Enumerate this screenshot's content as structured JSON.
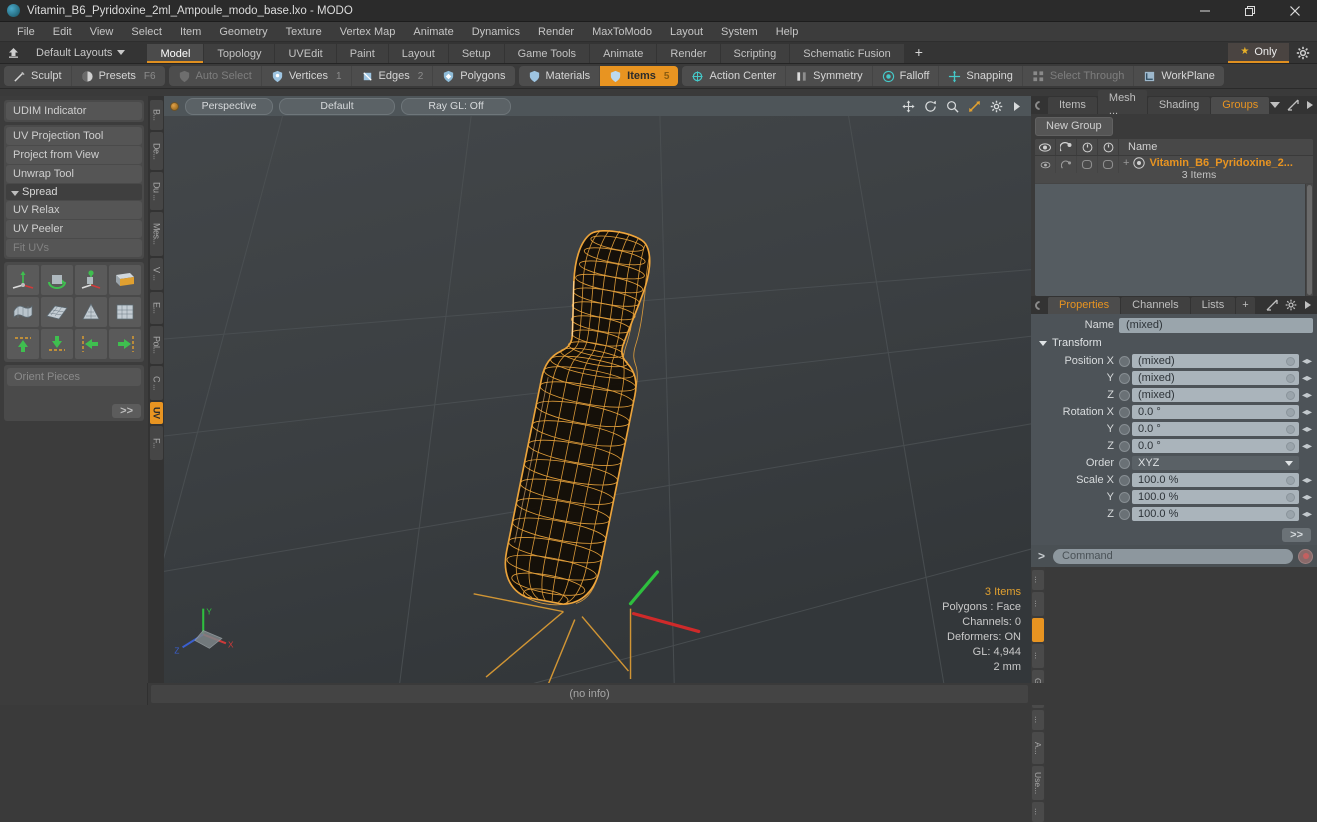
{
  "window": {
    "title": "Vitamin_B6_Pyridoxine_2ml_Ampoule_modo_base.lxo - MODO",
    "minimize": "minimize-icon",
    "restore": "restore-icon",
    "close": "close-icon"
  },
  "menubar": [
    {
      "label": "File"
    },
    {
      "label": "Edit"
    },
    {
      "label": "View"
    },
    {
      "label": "Select"
    },
    {
      "label": "Item"
    },
    {
      "label": "Geometry"
    },
    {
      "label": "Texture"
    },
    {
      "label": "Vertex Map"
    },
    {
      "label": "Animate"
    },
    {
      "label": "Dynamics"
    },
    {
      "label": "Render"
    },
    {
      "label": "MaxToModo"
    },
    {
      "label": "Layout"
    },
    {
      "label": "System"
    },
    {
      "label": "Help"
    }
  ],
  "layoutbar": {
    "home_icon": "home-icon",
    "preset_label": "Default Layouts",
    "tabs": [
      {
        "label": "Model",
        "active": true
      },
      {
        "label": "Topology",
        "active": false
      },
      {
        "label": "UVEdit",
        "active": false
      },
      {
        "label": "Paint",
        "active": false
      },
      {
        "label": "Layout",
        "active": false
      },
      {
        "label": "Setup",
        "active": false
      },
      {
        "label": "Game Tools",
        "active": false
      },
      {
        "label": "Animate",
        "active": false
      },
      {
        "label": "Render",
        "active": false
      },
      {
        "label": "Scripting",
        "active": false
      },
      {
        "label": "Schematic Fusion",
        "active": false
      }
    ],
    "add_tab": "+",
    "only_label": "Only",
    "gear_icon": "gear-icon"
  },
  "modebar": {
    "group1": [
      {
        "label": "Sculpt",
        "icon": "brush-icon",
        "state": "normal",
        "count": ""
      },
      {
        "label": "Presets",
        "icon": "sphere-icon",
        "state": "normal",
        "count": "F6"
      }
    ],
    "group2": [
      {
        "label": "Auto Select",
        "icon": "shield-icon",
        "state": "dim",
        "count": ""
      },
      {
        "label": "Vertices",
        "icon": "vertex-icon",
        "state": "normal",
        "count": "1"
      },
      {
        "label": "Edges",
        "icon": "edge-icon",
        "state": "normal",
        "count": "2"
      },
      {
        "label": "Polygons",
        "icon": "polygon-icon",
        "state": "normal",
        "count": ""
      }
    ],
    "group3": [
      {
        "label": "Materials",
        "icon": "material-icon",
        "state": "normal",
        "count": ""
      },
      {
        "label": "Items",
        "icon": "items-icon",
        "state": "on",
        "count": "5"
      }
    ],
    "group4": [
      {
        "label": "Action Center",
        "icon": "action-center-icon",
        "state": "normal",
        "count": ""
      },
      {
        "label": "Symmetry",
        "icon": "symmetry-icon",
        "state": "normal",
        "count": ""
      },
      {
        "label": "Falloff",
        "icon": "falloff-icon",
        "state": "normal",
        "count": ""
      },
      {
        "label": "Snapping",
        "icon": "snapping-icon",
        "state": "normal",
        "count": ""
      },
      {
        "label": "Select Through",
        "icon": "select-through-icon",
        "state": "dim",
        "count": ""
      },
      {
        "label": "WorkPlane",
        "icon": "workplane-icon",
        "state": "normal",
        "count": ""
      }
    ]
  },
  "leftpanel": {
    "udim": "UDIM Indicator",
    "tools": [
      "UV Projection Tool",
      "Project from View",
      "Unwrap Tool"
    ],
    "section": "Spread",
    "tools2": [
      "UV Relax",
      "UV Peeler"
    ],
    "tools2_disabled": "Fit UVs",
    "orient": "Orient Pieces",
    "more": ">>",
    "icon_row1": [
      "uv-move-icon",
      "uv-rotate-icon",
      "uv-scale-icon",
      "uv-flip-icon"
    ],
    "icon_row2": [
      "uv-drape-icon",
      "uv-grid-icon",
      "uv-cone-icon",
      "uv-cylinder-icon"
    ],
    "icon_row3": [
      "uv-align-top-icon",
      "uv-align-bottom-icon",
      "uv-align-left-icon",
      "uv-align-right-icon"
    ],
    "vtabs": [
      {
        "label": "B...",
        "active": false
      },
      {
        "label": "De...",
        "active": false
      },
      {
        "label": "Du ...",
        "active": false
      },
      {
        "label": "Mes...",
        "active": false
      },
      {
        "label": "V ...",
        "active": false
      },
      {
        "label": "E...",
        "active": false
      },
      {
        "label": "Pol...",
        "active": false
      },
      {
        "label": "C ...",
        "active": false
      },
      {
        "label": "UV",
        "active": true
      },
      {
        "label": "F...",
        "active": false
      }
    ]
  },
  "viewport": {
    "mode": "Perspective",
    "shading": "Default",
    "raygl": "Ray GL: Off",
    "icons": [
      "move-icon",
      "rotate-icon",
      "zoom-icon",
      "fit-icon",
      "gear-icon",
      "chevron-right-icon"
    ],
    "stats": {
      "items": "3 Items",
      "polygons": "Polygons : Face",
      "channels": "Channels: 0",
      "deformers": "Deformers: ON",
      "gl": "GL: 4,944",
      "scale": "2 mm"
    },
    "axis_gizmo": {
      "x": "X",
      "y": "Y",
      "z": "Z"
    }
  },
  "rightpanel": {
    "top_tabs": [
      {
        "label": "Items",
        "active": false
      },
      {
        "label": "Mesh ...",
        "active": false
      },
      {
        "label": "Shading",
        "active": false
      },
      {
        "label": "Groups",
        "active": true
      }
    ],
    "top_tools": [
      "chevron-down-icon",
      "expand-icon",
      "chevron-right-icon"
    ],
    "new_group": "New Group",
    "columns": [
      "visible-icon",
      "render-icon",
      "lock-icon",
      "wireframe-icon"
    ],
    "name_header": "Name",
    "row": {
      "name": "Vitamin_B6_Pyridoxine_2...",
      "sub": "3 Items",
      "expand": "+",
      "type_icon": "group-icon"
    },
    "prop_tabs": [
      {
        "label": "Properties",
        "active": true
      },
      {
        "label": "Channels",
        "active": false
      },
      {
        "label": "Lists",
        "active": false
      },
      {
        "label": "+",
        "active": false
      }
    ],
    "prop_tools": [
      "expand-icon",
      "gear-icon",
      "chevron-right-icon"
    ],
    "properties": {
      "name_label": "Name",
      "name_value": "(mixed)",
      "transform_section": "Transform",
      "rows": [
        {
          "label": "Position X",
          "value": "(mixed)",
          "type": "field"
        },
        {
          "label": "Y",
          "value": "(mixed)",
          "type": "field"
        },
        {
          "label": "Z",
          "value": "(mixed)",
          "type": "field"
        },
        {
          "label": "Rotation X",
          "value": "0.0 °",
          "type": "field"
        },
        {
          "label": "Y",
          "value": "0.0 °",
          "type": "field"
        },
        {
          "label": "Z",
          "value": "0.0 °",
          "type": "field"
        },
        {
          "label": "Order",
          "value": "XYZ",
          "type": "dropdown"
        },
        {
          "label": "Scale X",
          "value": "100.0 %",
          "type": "field"
        },
        {
          "label": "Y",
          "value": "100.0 %",
          "type": "field"
        },
        {
          "label": "Z",
          "value": "100.0 %",
          "type": "field"
        }
      ],
      "more": ">>"
    },
    "vtabs": [
      {
        "label": "...",
        "active": false
      },
      {
        "label": "...",
        "active": false
      },
      {
        "label": "",
        "active": true
      },
      {
        "label": "...",
        "active": false
      },
      {
        "label": "Gro...",
        "active": false
      },
      {
        "label": "...",
        "active": false
      },
      {
        "label": "A...",
        "active": false
      },
      {
        "label": "Use...",
        "active": false
      },
      {
        "label": "...",
        "active": false
      }
    ],
    "command": {
      "prompt": ">",
      "placeholder": "Command",
      "record_icon": "record-icon"
    }
  },
  "statusbar": {
    "info": "(no info)"
  },
  "colors": {
    "accent": "#e89421",
    "wireframe": "#e8a33c",
    "axis_x": "#d02a2a",
    "axis_y": "#2fbf3f",
    "axis_z": "#3a5fd0",
    "viewport_bg": "#3b3f42"
  }
}
